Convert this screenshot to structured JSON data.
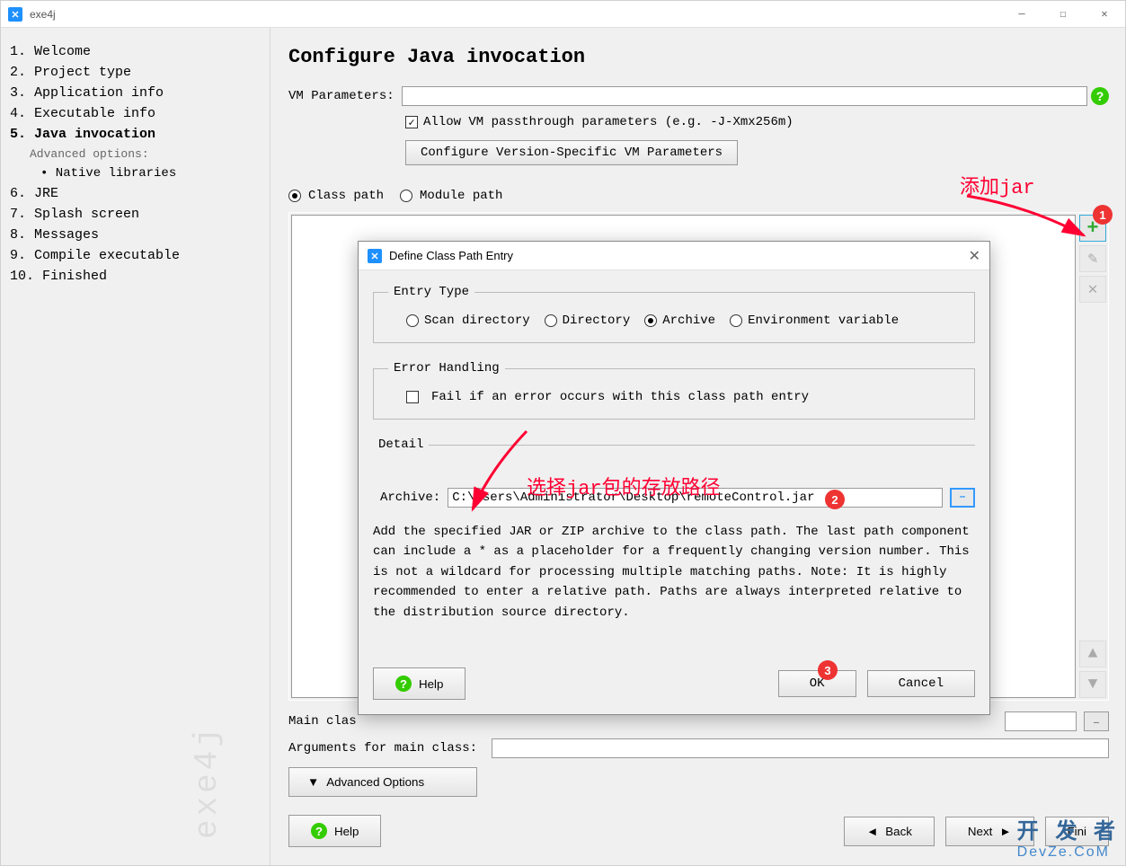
{
  "window": {
    "title": "exe4j"
  },
  "sidebar": {
    "items": [
      {
        "num": "1.",
        "label": "Welcome"
      },
      {
        "num": "2.",
        "label": "Project type"
      },
      {
        "num": "3.",
        "label": "Application info"
      },
      {
        "num": "4.",
        "label": "Executable info"
      },
      {
        "num": "5.",
        "label": "Java invocation",
        "active": true
      },
      {
        "num": "6.",
        "label": "JRE"
      },
      {
        "num": "7.",
        "label": "Splash screen"
      },
      {
        "num": "8.",
        "label": "Messages"
      },
      {
        "num": "9.",
        "label": "Compile executable"
      },
      {
        "num": "10.",
        "label": "Finished"
      }
    ],
    "sub_title": "Advanced options:",
    "sub_item": "• Native libraries"
  },
  "content": {
    "title": "Configure Java invocation",
    "vm_label": "VM Parameters:",
    "vm_value": "",
    "allow_passthrough": "Allow VM passthrough parameters (e.g. -J-Xmx256m)",
    "configure_btn": "Configure Version-Specific VM Parameters",
    "class_path": "Class path",
    "module_path": "Module path",
    "main_class_label": "Main clas",
    "args_label": "Arguments for main class:",
    "advanced_btn": "Advanced Options",
    "help_btn": "Help",
    "back_btn": "Back",
    "next_btn": "Next",
    "finish_btn": "Fini"
  },
  "dialog": {
    "title": "Define Class Path Entry",
    "entry_type_legend": "Entry Type",
    "opt_scan": "Scan directory",
    "opt_dir": "Directory",
    "opt_archive": "Archive",
    "opt_env": "Environment variable",
    "error_legend": "Error Handling",
    "fail_checkbox": "Fail if an error occurs with this class path entry",
    "detail_legend": "Detail",
    "archive_label": "Archive:",
    "archive_value": "C:\\Users\\Administrator\\Desktop\\remoteControl.jar",
    "desc": "Add the specified JAR or ZIP archive to the class path. The last path component can include a * as a placeholder for a frequently changing version number. This is not a wildcard for processing multiple matching paths. Note: It is highly recommended to enter a relative path. Paths are always interpreted relative to the distribution source directory.",
    "help": "Help",
    "ok": "OK",
    "cancel": "Cancel"
  },
  "annotations": {
    "add_jar": "添加jar",
    "select_jar": "选择jar包的存放路径",
    "badge1": "1",
    "badge2": "2",
    "badge3": "3"
  },
  "devze": {
    "cn": "开 发 者",
    "en": "DevZe.CoM"
  }
}
